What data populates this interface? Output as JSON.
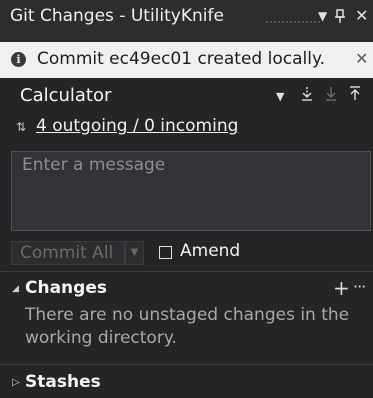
{
  "window": {
    "title": "Git Changes - UtilityKnife",
    "dropdown_icon": "▾",
    "pin_icon": "pin-icon",
    "close_icon": "close-icon"
  },
  "notification": {
    "text": "Commit ec49ec01 created locally.",
    "icon": "info-icon"
  },
  "branch": {
    "name": "Calculator"
  },
  "sync": {
    "link": "4 outgoing / 0 incoming"
  },
  "commit": {
    "message_placeholder": "Enter a message",
    "commit_all_label": "Commit All",
    "amend_label": "Amend"
  },
  "changes": {
    "title": "Changes",
    "empty_text": "There are no unstaged changes in the working directory."
  },
  "stashes": {
    "title": "Stashes"
  },
  "colors": {
    "background": "#252526",
    "infobar": "#f0f0f0",
    "text": "#ffffff",
    "muted": "#a8a8a8"
  }
}
